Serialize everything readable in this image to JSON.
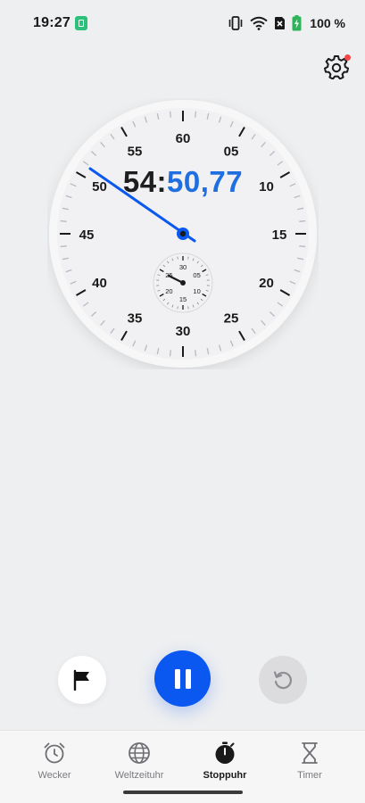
{
  "status_bar": {
    "time": "19:27",
    "battery": "100 %",
    "icons": [
      "notification-app-icon",
      "vibrate-icon",
      "wifi-icon",
      "no-sim-icon",
      "battery-charging-icon"
    ]
  },
  "settings": {
    "icon": "gear-icon",
    "has_badge": true
  },
  "stopwatch": {
    "minutes": "54:",
    "seconds": "50,77",
    "dial_labels": [
      "60",
      "05",
      "10",
      "15",
      "20",
      "25",
      "30",
      "35",
      "40",
      "45",
      "50",
      "55"
    ],
    "subdial_labels": [
      "30",
      "05",
      "10",
      "15",
      "20",
      "25"
    ]
  },
  "controls": {
    "lap": "flag-icon",
    "pause": "pause-icon",
    "reset": "reset-icon"
  },
  "nav": {
    "items": [
      {
        "label": "Wecker",
        "icon": "alarm-clock-icon"
      },
      {
        "label": "Weltzeituhr",
        "icon": "globe-icon"
      },
      {
        "label": "Stoppuhr",
        "icon": "stopwatch-icon"
      },
      {
        "label": "Timer",
        "icon": "hourglass-icon"
      }
    ],
    "active": "Stoppuhr"
  },
  "colors": {
    "accent": "#0a58f0",
    "seconds_text": "#1f6fe0",
    "background": "#eeeff1",
    "badge": "#f04646"
  }
}
